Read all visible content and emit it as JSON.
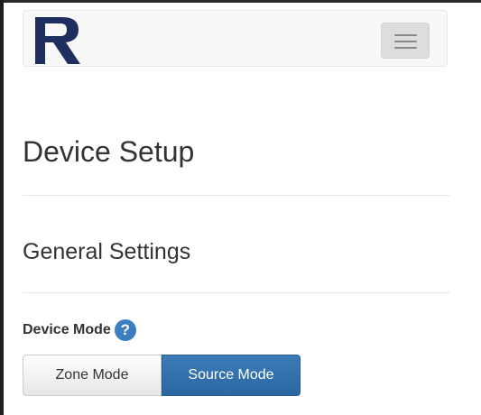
{
  "navbar": {
    "logo_icon": "russound-r-logo-icon",
    "menu_icon": "hamburger-menu-icon"
  },
  "page": {
    "title": "Device Setup"
  },
  "general_settings": {
    "title": "General Settings",
    "device_mode": {
      "label": "Device Mode",
      "help_icon": "question-circle-icon",
      "help_glyph": "?",
      "options": [
        {
          "label": "Zone Mode",
          "selected": false
        },
        {
          "label": "Source Mode",
          "selected": true
        }
      ]
    }
  },
  "colors": {
    "brand_navy": "#1d2f5e",
    "accent_blue": "#2f6ea8",
    "help_blue": "#3b7fc0"
  }
}
